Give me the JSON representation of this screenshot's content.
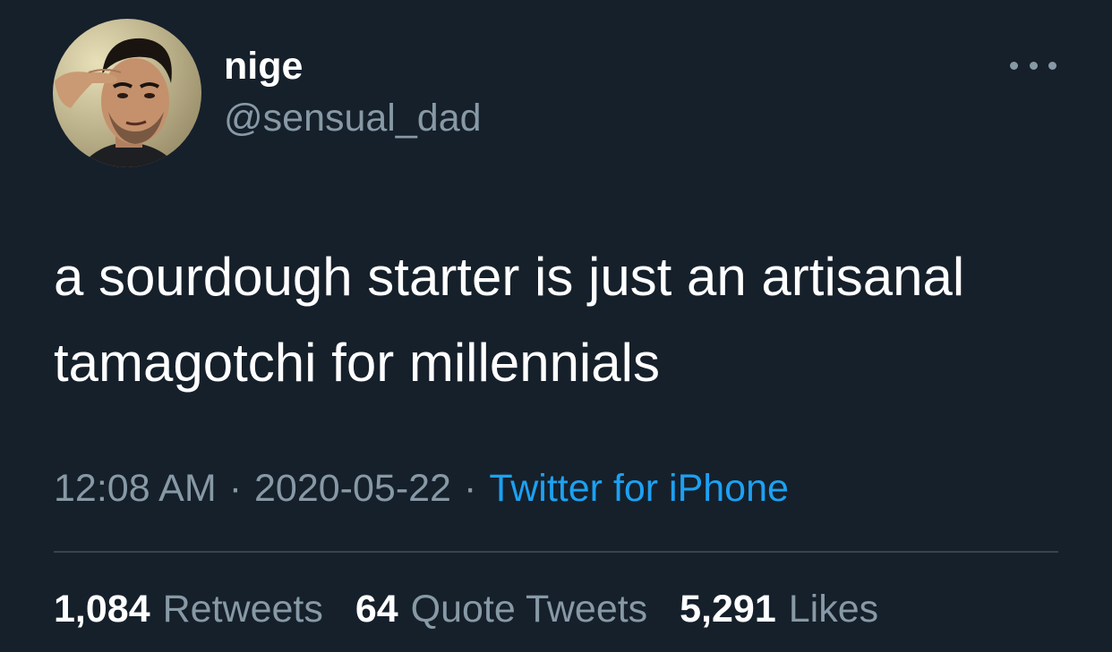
{
  "user": {
    "display_name": "nige",
    "handle": "@sensual_dad"
  },
  "tweet": {
    "text_line1": "a sourdough starter is just an artisanal",
    "text_line2": "tamagotchi for millennials"
  },
  "meta": {
    "time": "12:08 AM",
    "separator": "·",
    "date": "2020-05-22",
    "source": "Twitter for iPhone"
  },
  "stats": {
    "retweets_count": "1,084",
    "retweets_label": "Retweets",
    "quotes_count": "64",
    "quotes_label": "Quote Tweets",
    "likes_count": "5,291",
    "likes_label": "Likes"
  },
  "colors": {
    "background": "#15202b",
    "primary_text": "#ffffff",
    "secondary_text": "#8899a6",
    "link": "#1da1f2",
    "divider": "#38444d"
  },
  "icons": {
    "more": "more-horizontal-icon"
  }
}
